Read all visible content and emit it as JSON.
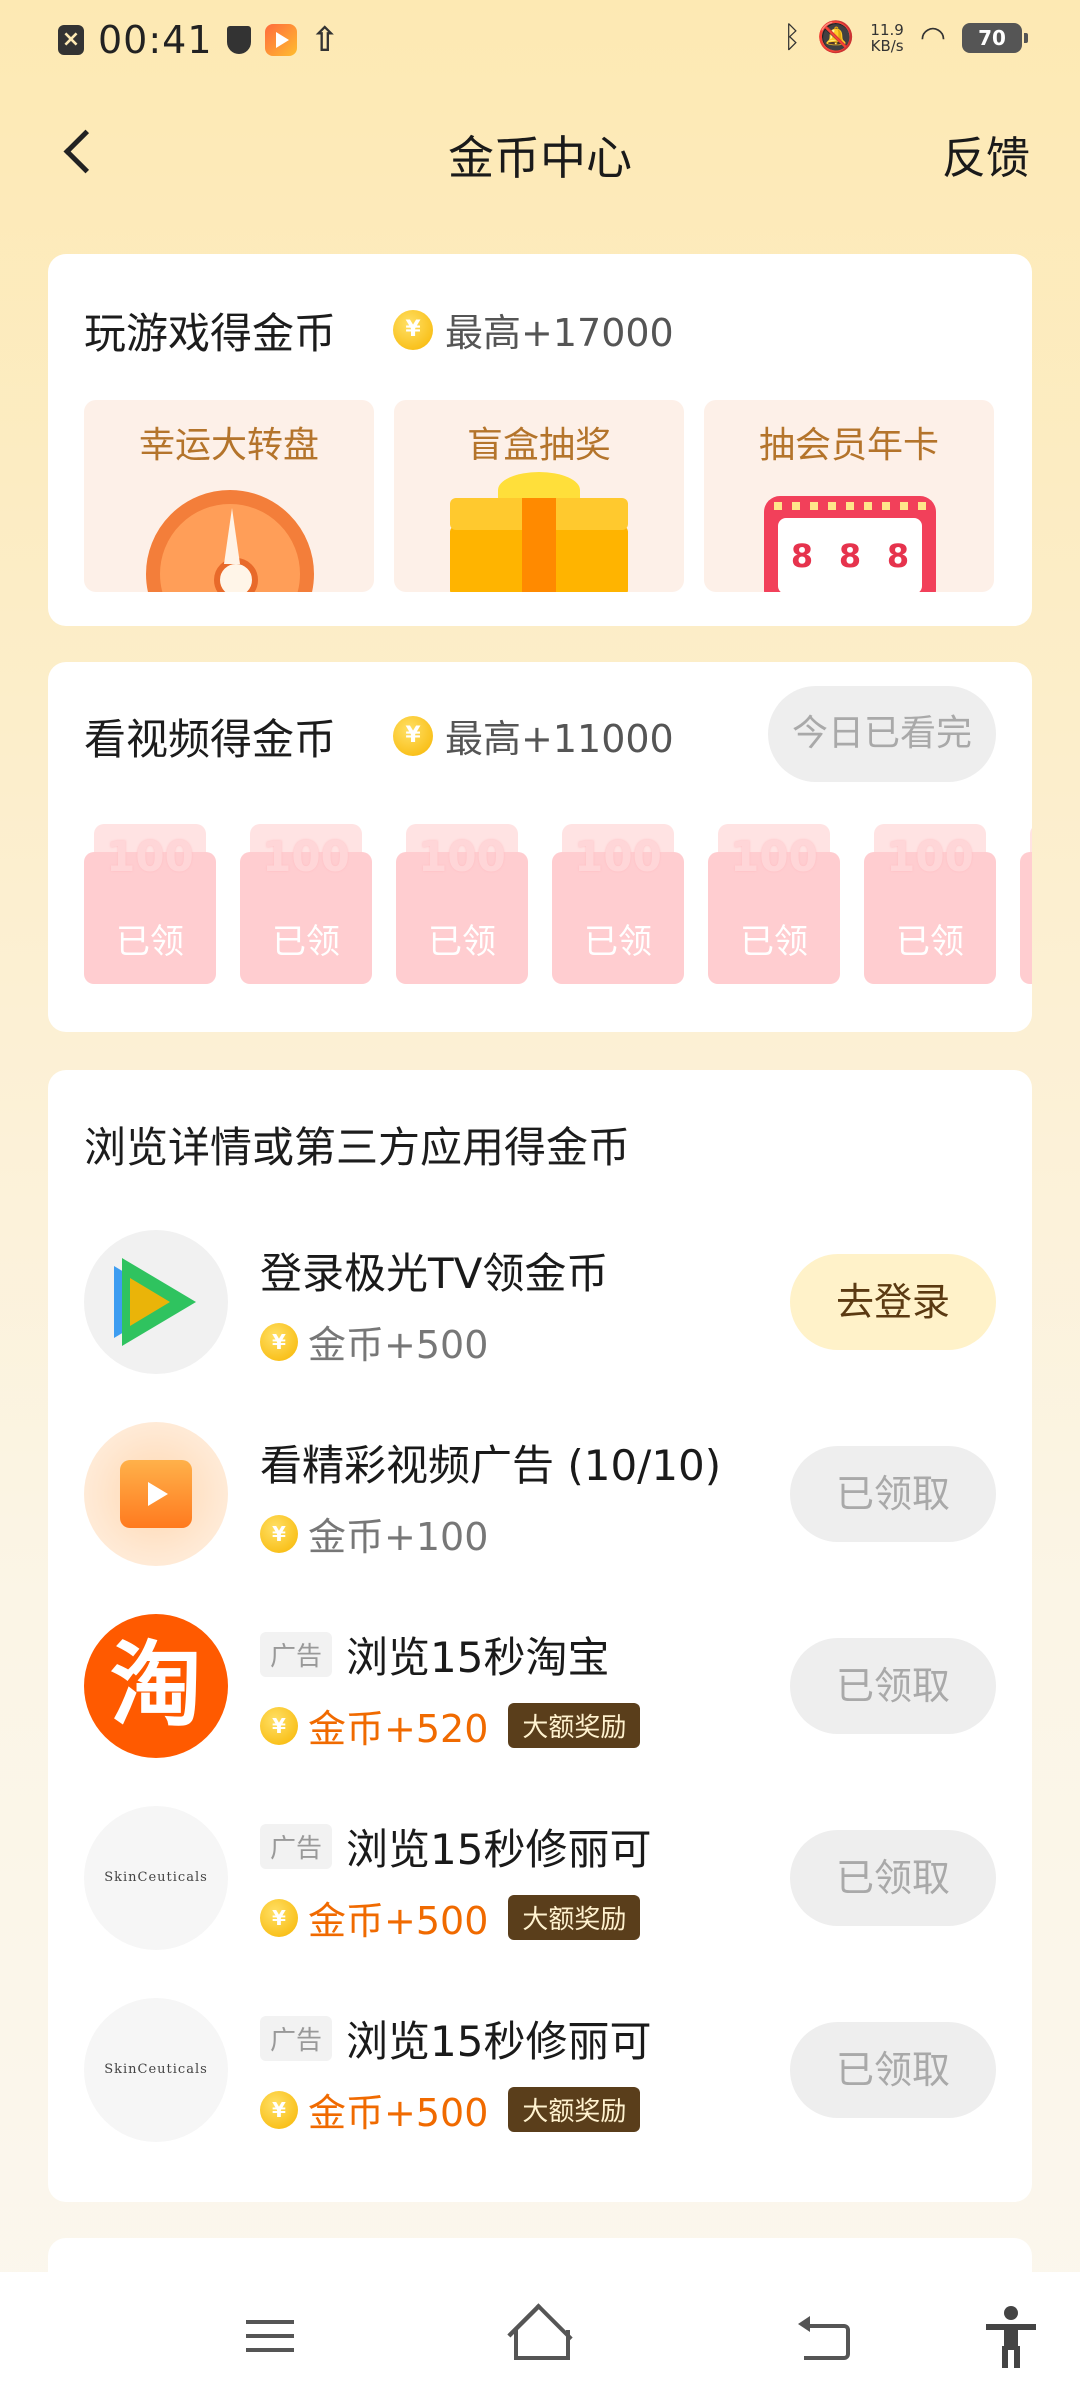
{
  "status_bar": {
    "time": "00:41",
    "net_speed_value": "11.9",
    "net_speed_unit": "KB/s",
    "battery": "70",
    "icons": [
      "notification-x-icon",
      "shield-icon",
      "video-app-icon",
      "upload-icon",
      "bluetooth-icon",
      "mute-bell-icon",
      "wifi-icon",
      "battery-icon"
    ]
  },
  "header": {
    "title": "金币中心",
    "feedback": "反馈"
  },
  "games": {
    "title": "玩游戏得金币",
    "max_reward": "最高+17000",
    "tiles": [
      {
        "label": "幸运大转盘",
        "icon": "wheel"
      },
      {
        "label": "盲盒抽奖",
        "icon": "gift-box"
      },
      {
        "label": "抽会员年卡",
        "icon": "slot-machine",
        "digits": [
          "8",
          "8",
          "8"
        ]
      }
    ]
  },
  "videos": {
    "title": "看视频得金币",
    "max_reward": "最高+11000",
    "status_chip": "今日已看完",
    "envelopes": [
      {
        "amount": "100",
        "status": "已领"
      },
      {
        "amount": "100",
        "status": "已领"
      },
      {
        "amount": "100",
        "status": "已领"
      },
      {
        "amount": "100",
        "status": "已领"
      },
      {
        "amount": "100",
        "status": "已领"
      },
      {
        "amount": "100",
        "status": "已领"
      }
    ]
  },
  "browse": {
    "title": "浏览详情或第三方应用得金币",
    "ad_tag": "广告",
    "big_badge": "大额奖励",
    "tasks": [
      {
        "name": "登录极光TV领金币",
        "reward": "金币+500",
        "button": "去登录",
        "icon": "jiguang-tv-icon"
      },
      {
        "name": "看精彩视频广告 (10/10)",
        "reward": "金币+100",
        "button": "已领取",
        "icon": "video-ad-icon"
      },
      {
        "name": "浏览15秒淘宝",
        "reward": "金币+520",
        "button": "已领取",
        "icon": "taobao-icon",
        "icon_text": "淘"
      },
      {
        "name": "浏览15秒修丽可",
        "reward": "金币+500",
        "button": "已领取",
        "icon": "skinceuticals-icon",
        "icon_text": "SkinCeuticals"
      },
      {
        "name": "浏览15秒修丽可",
        "reward": "金币+500",
        "button": "已领取",
        "icon": "skinceuticals-icon",
        "icon_text": "SkinCeuticals"
      }
    ]
  },
  "coin_symbol": "¥",
  "colors": {
    "accent_orange": "#f06a00",
    "brown_text": "#b4742b",
    "badge_bg": "#5a3e1b",
    "bg_top": "#fde9b3"
  }
}
